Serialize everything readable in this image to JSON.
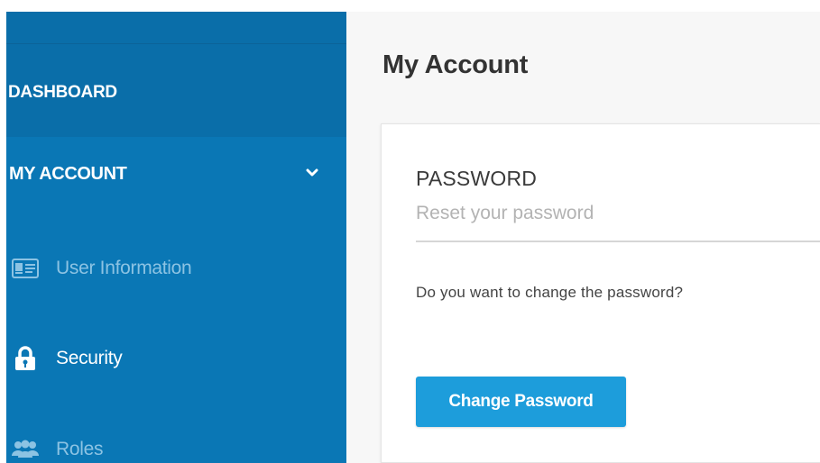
{
  "sidebar": {
    "dashboard_label": "DASHBOARD",
    "my_account_label": "MY ACCOUNT",
    "items": [
      {
        "label": "User Information",
        "icon": "id-card-icon"
      },
      {
        "label": "Security",
        "icon": "lock-icon"
      },
      {
        "label": "Roles",
        "icon": "users-icon"
      }
    ]
  },
  "main": {
    "page_title": "My Account",
    "card": {
      "title": "PASSWORD",
      "subtitle": "Reset your password",
      "question": "Do you want to change the password?",
      "button_label": "Change Password"
    }
  },
  "colors": {
    "sidebar_bg": "#0a77b5",
    "sidebar_header_bg": "#0a6ea9",
    "sidebar_muted_text": "#8cc3e3",
    "accent_button": "#1d9ddb",
    "main_bg": "#f7f7f7"
  }
}
